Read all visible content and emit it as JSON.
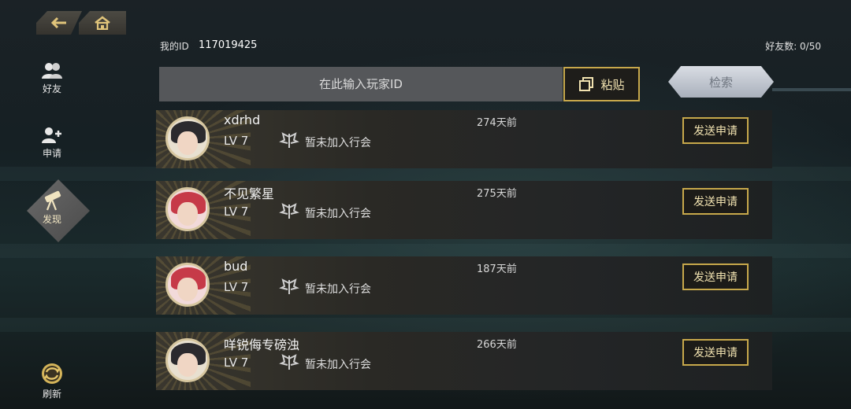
{
  "nav": {
    "back_icon": "back-arrow-icon",
    "home_icon": "home-icon"
  },
  "sidebar": {
    "items": [
      {
        "label": "好友",
        "icon": "friends-icon"
      },
      {
        "label": "申请",
        "icon": "add-friend-icon"
      },
      {
        "label": "发现",
        "icon": "telescope-icon",
        "active": true
      },
      {
        "label": "刷新",
        "icon": "refresh-icon"
      }
    ]
  },
  "header": {
    "id_label": "我的ID",
    "id_value": "117019425",
    "friend_count": "好友数: 0/50"
  },
  "search": {
    "placeholder": "在此输入玩家ID",
    "paste_label": "粘贴",
    "search_label": "检索"
  },
  "players": [
    {
      "name": "xdrhd",
      "level": "LV 7",
      "guild": "暂未加入行会",
      "time": "274天前",
      "action": "发送申请",
      "avatar": "dark"
    },
    {
      "name": "不见繁星",
      "level": "LV 7",
      "guild": "暂未加入行会",
      "time": "275天前",
      "action": "发送申请",
      "avatar": "red"
    },
    {
      "name": "bud",
      "level": "LV 7",
      "guild": "暂未加入行会",
      "time": "187天前",
      "action": "发送申请",
      "avatar": "red"
    },
    {
      "name": "咩锐侮专磅浊",
      "level": "LV 7",
      "guild": "暂未加入行会",
      "time": "266天前",
      "action": "发送申请",
      "avatar": "dark"
    }
  ],
  "colors": {
    "accent_gold": "#c7a84b",
    "input_bg": "#55575a",
    "search_btn": "#c0c6cf"
  }
}
